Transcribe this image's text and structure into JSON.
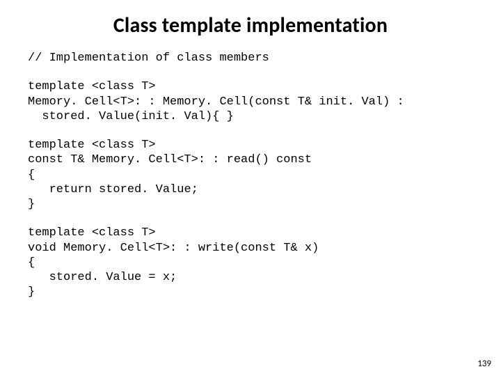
{
  "title": "Class template implementation",
  "code": {
    "comment": "// Implementation of class members",
    "block1": "template <class T>\nMemory. Cell<T>: : Memory. Cell(const T& init. Val) :\n  stored. Value(init. Val){ }",
    "block2": "template <class T>\nconst T& Memory. Cell<T>: : read() const\n{\n   return stored. Value;\n}",
    "block3": "template <class T>\nvoid Memory. Cell<T>: : write(const T& x)\n{\n   stored. Value = x;\n}"
  },
  "page_number": "139"
}
